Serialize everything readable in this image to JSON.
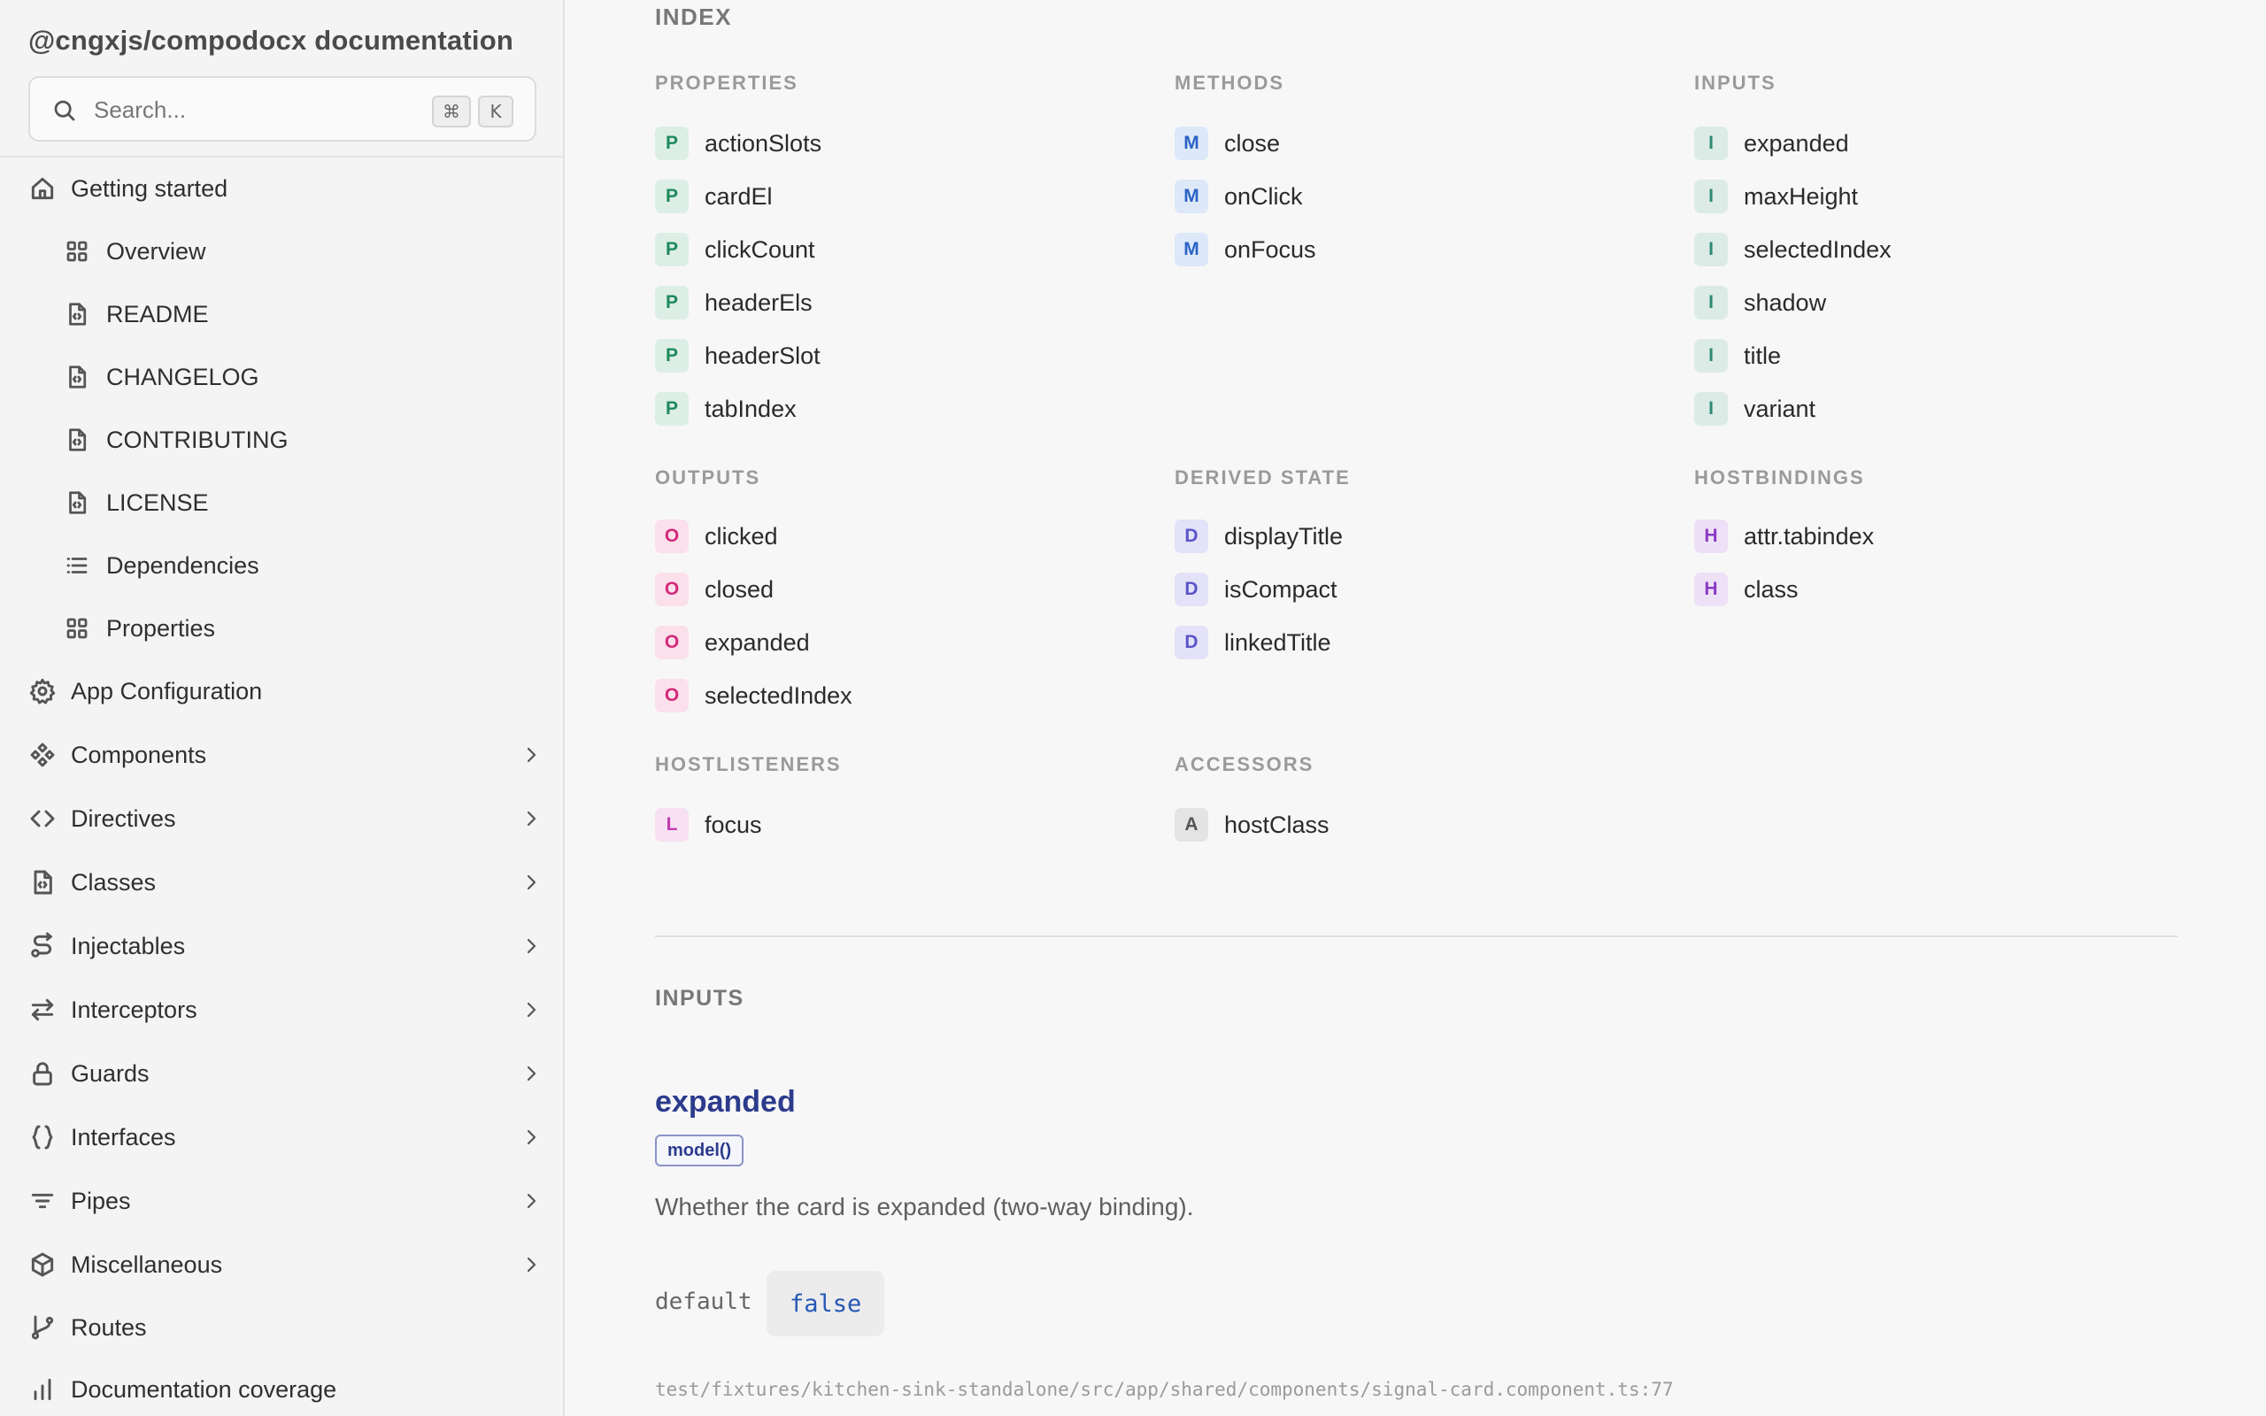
{
  "sidebar": {
    "title": "@cngxjs/compodocx documentation",
    "search": {
      "placeholder": "Search...",
      "shortcut_mod": "⌘",
      "shortcut_key": "K"
    },
    "items": [
      {
        "label": "Getting started",
        "icon": "home-icon"
      },
      {
        "label": "Overview",
        "icon": "grid-icon"
      },
      {
        "label": "README",
        "icon": "file-code-icon"
      },
      {
        "label": "CHANGELOG",
        "icon": "file-code-icon"
      },
      {
        "label": "CONTRIBUTING",
        "icon": "file-code-icon"
      },
      {
        "label": "LICENSE",
        "icon": "file-code-icon"
      },
      {
        "label": "Dependencies",
        "icon": "list-icon"
      },
      {
        "label": "Properties",
        "icon": "grid-icon"
      },
      {
        "label": "App Configuration",
        "icon": "gear-icon"
      },
      {
        "label": "Components",
        "icon": "components-icon"
      },
      {
        "label": "Directives",
        "icon": "code-icon"
      },
      {
        "label": "Classes",
        "icon": "file-code-icon"
      },
      {
        "label": "Injectables",
        "icon": "route-icon"
      },
      {
        "label": "Interceptors",
        "icon": "arrows-icon"
      },
      {
        "label": "Guards",
        "icon": "lock-icon"
      },
      {
        "label": "Interfaces",
        "icon": "braces-icon"
      },
      {
        "label": "Pipes",
        "icon": "filter-icon"
      },
      {
        "label": "Miscellaneous",
        "icon": "cube-icon"
      },
      {
        "label": "Routes",
        "icon": "git-branch-icon"
      },
      {
        "label": "Documentation coverage",
        "icon": "bar-chart-icon"
      }
    ]
  },
  "index": {
    "title": "INDEX",
    "groups": {
      "properties": {
        "title": "PROPERTIES",
        "badge": "P",
        "items": [
          "actionSlots",
          "cardEl",
          "clickCount",
          "headerEls",
          "headerSlot",
          "tabIndex"
        ]
      },
      "methods": {
        "title": "METHODS",
        "badge": "M",
        "items": [
          "close",
          "onClick",
          "onFocus"
        ]
      },
      "inputs": {
        "title": "INPUTS",
        "badge": "I",
        "items": [
          "expanded",
          "maxHeight",
          "selectedIndex",
          "shadow",
          "title",
          "variant"
        ]
      },
      "outputs": {
        "title": "OUTPUTS",
        "badge": "O",
        "items": [
          "clicked",
          "closed",
          "expanded",
          "selectedIndex"
        ]
      },
      "derived": {
        "title": "DERIVED STATE",
        "badge": "D",
        "items": [
          "displayTitle",
          "isCompact",
          "linkedTitle"
        ]
      },
      "hostbindings": {
        "title": "HOSTBINDINGS",
        "badge": "H",
        "items": [
          "attr.tabindex",
          "class"
        ]
      },
      "hostlisteners": {
        "title": "HOSTLISTENERS",
        "badge": "L",
        "items": [
          "focus"
        ]
      },
      "accessors": {
        "title": "ACCESSORS",
        "badge": "A",
        "items": [
          "hostClass"
        ]
      }
    }
  },
  "inputs_section": {
    "title": "INPUTS",
    "name": "expanded",
    "tag": "model()",
    "description": "Whether the card is expanded (two-way binding).",
    "default_label": "default",
    "default_value": "false",
    "source": "test/fixtures/kitchen-sink-standalone/src/app/shared/components/signal-card.component.ts:77"
  }
}
